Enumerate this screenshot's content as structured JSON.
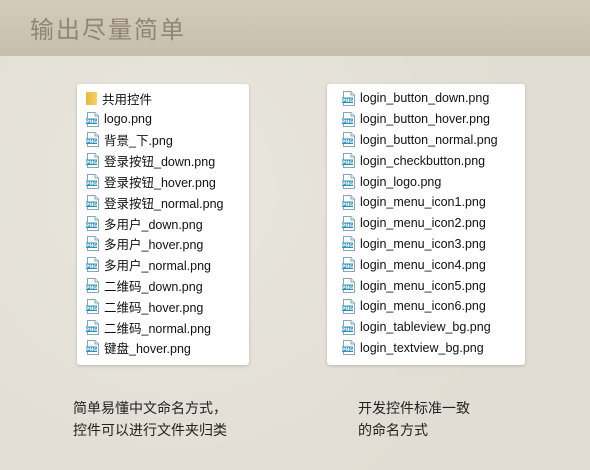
{
  "header": {
    "title": "输出尽量简单"
  },
  "left_panel": {
    "items": [
      {
        "icon": "folder-icon",
        "name": "共用控件"
      },
      {
        "icon": "png-file-icon",
        "name": "logo.png"
      },
      {
        "icon": "png-file-icon",
        "name": "背景_下.png"
      },
      {
        "icon": "png-file-icon",
        "name": "登录按钮_down.png"
      },
      {
        "icon": "png-file-icon",
        "name": "登录按钮_hover.png"
      },
      {
        "icon": "png-file-icon",
        "name": "登录按钮_normal.png"
      },
      {
        "icon": "png-file-icon",
        "name": "多用户_down.png"
      },
      {
        "icon": "png-file-icon",
        "name": "多用户_hover.png"
      },
      {
        "icon": "png-file-icon",
        "name": "多用户_normal.png"
      },
      {
        "icon": "png-file-icon",
        "name": "二维码_down.png"
      },
      {
        "icon": "png-file-icon",
        "name": "二维码_hover.png"
      },
      {
        "icon": "png-file-icon",
        "name": "二维码_normal.png"
      },
      {
        "icon": "png-file-icon",
        "name": "键盘_hover.png"
      }
    ]
  },
  "right_panel": {
    "items": [
      {
        "icon": "png-file-icon",
        "name": "login_button_down.png"
      },
      {
        "icon": "png-file-icon",
        "name": "login_button_hover.png"
      },
      {
        "icon": "png-file-icon",
        "name": "login_button_normal.png"
      },
      {
        "icon": "png-file-icon",
        "name": "login_checkbutton.png"
      },
      {
        "icon": "png-file-icon",
        "name": "login_logo.png"
      },
      {
        "icon": "png-file-icon",
        "name": "login_menu_icon1.png"
      },
      {
        "icon": "png-file-icon",
        "name": "login_menu_icon2.png"
      },
      {
        "icon": "png-file-icon",
        "name": "login_menu_icon3.png"
      },
      {
        "icon": "png-file-icon",
        "name": "login_menu_icon4.png"
      },
      {
        "icon": "png-file-icon",
        "name": "login_menu_icon5.png"
      },
      {
        "icon": "png-file-icon",
        "name": "login_menu_icon6.png"
      },
      {
        "icon": "png-file-icon",
        "name": "login_tableview_bg.png"
      },
      {
        "icon": "png-file-icon",
        "name": "login_textview_bg.png"
      }
    ]
  },
  "captions": {
    "left": {
      "line1": "简单易懂中文命名方式，",
      "line2": "控件可以进行文件夹归类"
    },
    "right": {
      "line1": "开发控件标准一致",
      "line2": "的命名方式"
    }
  }
}
